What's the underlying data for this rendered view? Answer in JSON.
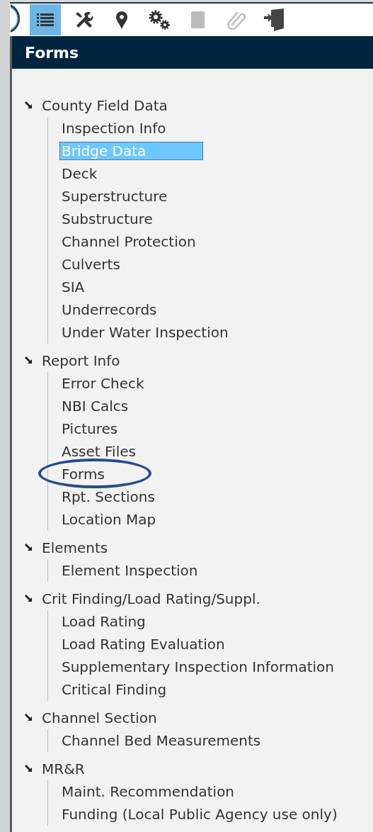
{
  "toolbar": [
    {
      "kind": "list",
      "selected": true,
      "disabled": false
    },
    {
      "kind": "tools",
      "selected": false,
      "disabled": false
    },
    {
      "kind": "pin",
      "selected": false,
      "disabled": false
    },
    {
      "kind": "gears",
      "selected": false,
      "disabled": false
    },
    {
      "kind": "book",
      "selected": false,
      "disabled": true
    },
    {
      "kind": "clip",
      "selected": false,
      "disabled": true
    },
    {
      "kind": "exit",
      "selected": false,
      "disabled": false
    }
  ],
  "panel": {
    "title": "Forms"
  },
  "tree": [
    {
      "label": "County Field Data",
      "expanded": true,
      "children": [
        {
          "label": "Inspection Info",
          "selected": false,
          "circled": false
        },
        {
          "label": "Bridge Data",
          "selected": true,
          "circled": false
        },
        {
          "label": "Deck",
          "selected": false,
          "circled": false
        },
        {
          "label": "Superstructure",
          "selected": false,
          "circled": false
        },
        {
          "label": "Substructure",
          "selected": false,
          "circled": false
        },
        {
          "label": "Channel Protection",
          "selected": false,
          "circled": false
        },
        {
          "label": "Culverts",
          "selected": false,
          "circled": false
        },
        {
          "label": "SIA",
          "selected": false,
          "circled": false
        },
        {
          "label": "Underrecords",
          "selected": false,
          "circled": false
        },
        {
          "label": "Under Water Inspection",
          "selected": false,
          "circled": false
        }
      ]
    },
    {
      "label": "Report Info",
      "expanded": true,
      "children": [
        {
          "label": "Error Check",
          "selected": false,
          "circled": false
        },
        {
          "label": "NBI Calcs",
          "selected": false,
          "circled": false
        },
        {
          "label": "Pictures",
          "selected": false,
          "circled": false
        },
        {
          "label": "Asset Files",
          "selected": false,
          "circled": false
        },
        {
          "label": "Forms",
          "selected": false,
          "circled": true
        },
        {
          "label": "Rpt. Sections",
          "selected": false,
          "circled": false
        },
        {
          "label": "Location Map",
          "selected": false,
          "circled": false
        }
      ]
    },
    {
      "label": "Elements",
      "expanded": true,
      "children": [
        {
          "label": "Element Inspection",
          "selected": false,
          "circled": false
        }
      ]
    },
    {
      "label": "Crit Finding/Load Rating/Suppl.",
      "expanded": true,
      "children": [
        {
          "label": "Load Rating",
          "selected": false,
          "circled": false
        },
        {
          "label": "Load Rating Evaluation",
          "selected": false,
          "circled": false
        },
        {
          "label": "Supplementary Inspection Information",
          "selected": false,
          "circled": false
        },
        {
          "label": "Critical Finding",
          "selected": false,
          "circled": false
        }
      ]
    },
    {
      "label": "Channel Section",
      "expanded": true,
      "children": [
        {
          "label": "Channel Bed Measurements",
          "selected": false,
          "circled": false
        }
      ]
    },
    {
      "label": "MR&R",
      "expanded": true,
      "children": [
        {
          "label": "Maint. Recommendation",
          "selected": false,
          "circled": false
        },
        {
          "label": "Funding (Local Public Agency use only)",
          "selected": false,
          "circled": false
        }
      ]
    }
  ]
}
